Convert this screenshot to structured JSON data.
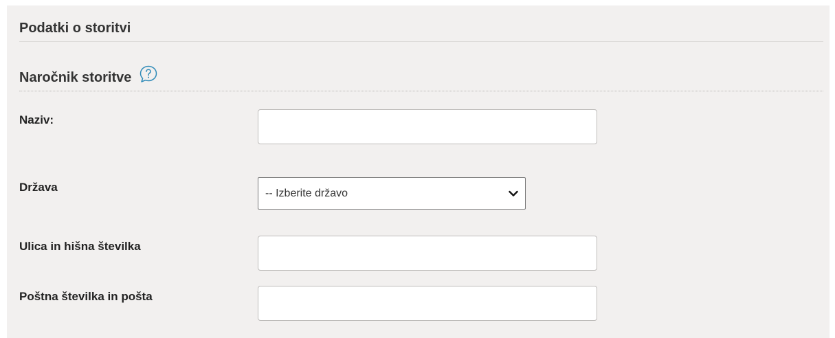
{
  "section": {
    "title": "Podatki o storitvi"
  },
  "customer": {
    "title": "Naročnik storitve",
    "help_icon": "help-speech-bubble-icon"
  },
  "form": {
    "name_label": "Naziv:",
    "name_value": "",
    "country_label": "Država",
    "country_selected": "-- Izberite državo",
    "street_label": "Ulica in hišna številka",
    "street_value": "",
    "postal_label": "Poštna številka in pošta",
    "postal_value": ""
  },
  "colors": {
    "panel_background": "#f2f0ef",
    "help_icon": "#2e8ab8",
    "input_border": "#bdbbb9"
  }
}
